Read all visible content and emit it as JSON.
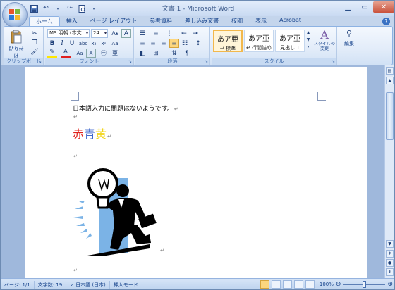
{
  "window": {
    "title": "文書 1 - Microsoft Word",
    "controls": [
      "minimize",
      "maximize",
      "close"
    ]
  },
  "quick_access": [
    "save-icon",
    "undo-icon",
    "redo-icon",
    "print-preview-icon",
    "customize-icon"
  ],
  "tabs": [
    {
      "label": "ホーム",
      "active": true
    },
    {
      "label": "挿入",
      "active": false
    },
    {
      "label": "ページ レイアウト",
      "active": false
    },
    {
      "label": "参考資料",
      "active": false
    },
    {
      "label": "差し込み文書",
      "active": false
    },
    {
      "label": "校閲",
      "active": false
    },
    {
      "label": "表示",
      "active": false
    },
    {
      "label": "Acrobat",
      "active": false
    }
  ],
  "ribbon": {
    "clipboard": {
      "label": "クリップボード",
      "paste_label": "貼り付け"
    },
    "font": {
      "label": "フォント",
      "font_name": "MS 明朝 (本文",
      "font_size": "24",
      "bold": "B",
      "italic": "I",
      "underline": "U"
    },
    "paragraph": {
      "label": "段落"
    },
    "styles": {
      "label": "スタイル",
      "items": [
        {
          "preview": "あア亜",
          "name": "↵ 標準",
          "selected": true
        },
        {
          "preview": "あア亜",
          "name": "↵ 行間詰め",
          "selected": false
        },
        {
          "preview": "あア亜",
          "name": "見出し 1",
          "selected": false
        }
      ],
      "change_label": "スタイルの変更"
    },
    "editing": {
      "label": "編集"
    }
  },
  "document": {
    "line1": "日本語入力に問題はないようです。",
    "colored_words": [
      {
        "text": "赤",
        "color": "#e0201a"
      },
      {
        "text": "青",
        "color": "#2a57c8"
      },
      {
        "text": "黄",
        "color": "#f2d51a"
      }
    ],
    "para_mark": "↵"
  },
  "status": {
    "page": "ページ: 1/1",
    "words": "文字数: 19",
    "language": "日本語 (日本)",
    "mode": "挿入モード",
    "zoom": "100%"
  }
}
